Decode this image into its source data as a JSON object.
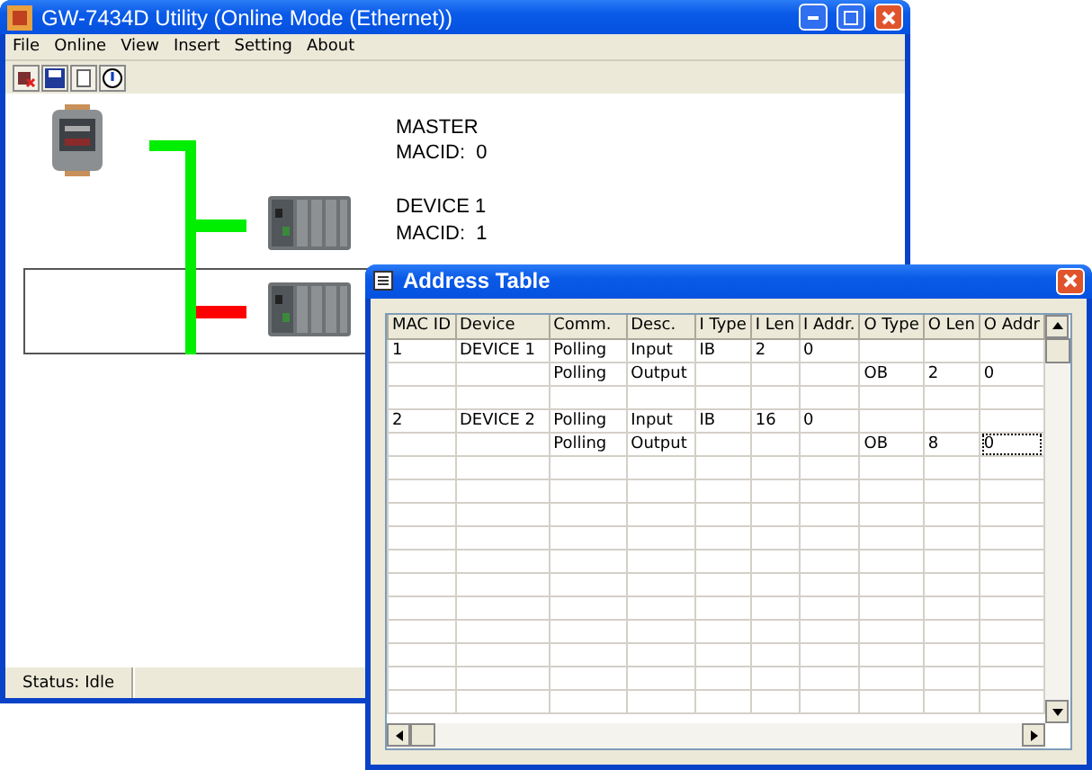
{
  "main_window": {
    "title": "GW-7434D Utility (Online Mode (Ethernet))",
    "menu": [
      "File",
      "Online",
      "View",
      "Insert",
      "Setting",
      "About"
    ],
    "nodes": [
      {
        "kind": "master",
        "name": "MASTER",
        "macid": "MACID:  0"
      },
      {
        "kind": "device",
        "name": "DEVICE 1",
        "macid": "MACID:  1",
        "color": "#00ee00",
        "selected": false
      },
      {
        "kind": "device",
        "color": "#ff0000",
        "selected": true
      }
    ],
    "status_bar": [
      "Status: Idle"
    ]
  },
  "address_table": {
    "title": "Address Table",
    "columns": [
      "MAC ID",
      "Device",
      "Comm.",
      "Desc.",
      "I Type",
      "I Len",
      "I Addr.",
      "O Type",
      "O Len",
      "O Addr"
    ],
    "rows": [
      {
        "cells": [
          {
            "text": "1"
          },
          {
            "text": "DEVICE 1"
          },
          {
            "text": "Polling"
          },
          {
            "text": "Input"
          },
          {
            "text": "IB"
          },
          {
            "text": "2"
          },
          {
            "text": "0"
          },
          {},
          {},
          {}
        ]
      },
      {
        "cells": [
          {},
          {},
          {
            "text": "Polling"
          },
          {
            "text": "Output"
          },
          {},
          {},
          {},
          {
            "text": "OB"
          },
          {
            "text": "2"
          },
          {
            "text": "0"
          }
        ]
      },
      {
        "cells": []
      },
      {
        "cells": [
          {
            "text": "2"
          },
          {
            "text": "DEVICE 2"
          },
          {
            "text": "Polling"
          },
          {
            "text": "Input"
          },
          {
            "text": "IB"
          },
          {
            "text": "16"
          },
          {
            "text": "0"
          },
          {},
          {},
          {}
        ]
      },
      {
        "cells": [
          {},
          {},
          {
            "text": "Polling"
          },
          {
            "text": "Output"
          },
          {},
          {},
          {},
          {
            "text": "OB"
          },
          {
            "text": "8"
          },
          {
            "text": "0",
            "focused": true
          }
        ]
      }
    ]
  }
}
